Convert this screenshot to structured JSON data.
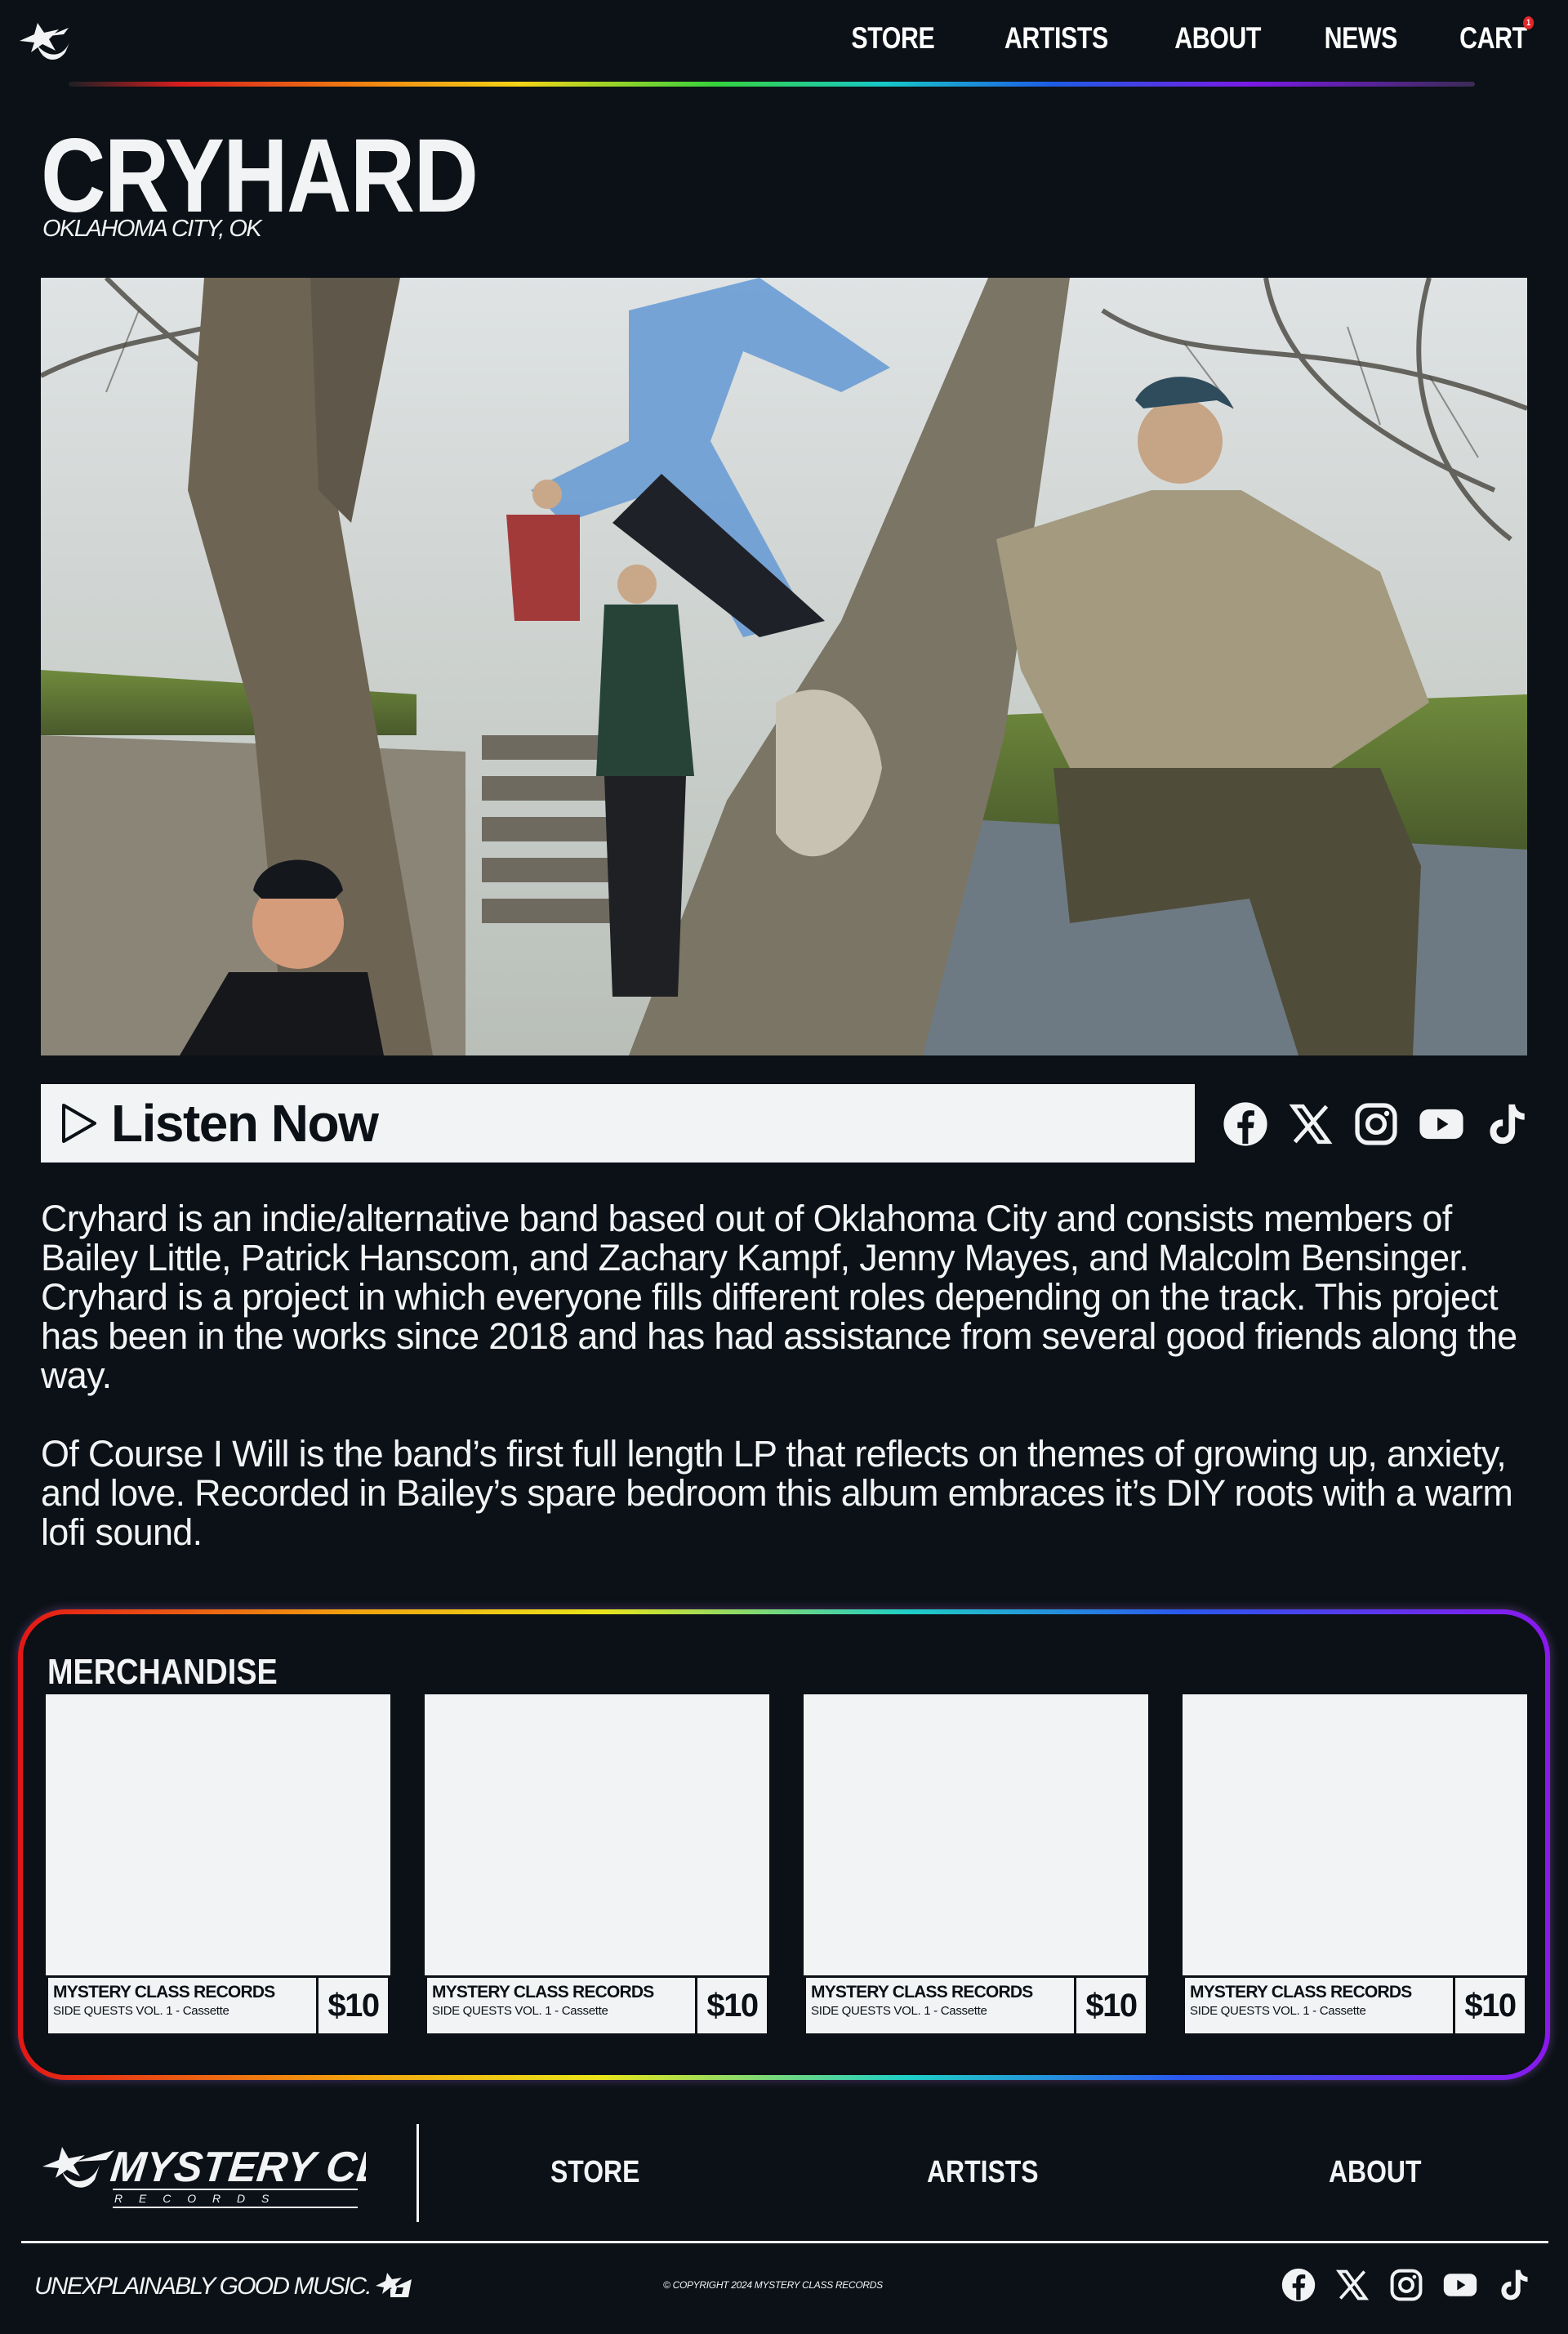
{
  "header": {
    "logo_icon": "star-swoosh-logo-icon",
    "nav": [
      {
        "label": "STORE"
      },
      {
        "label": "ARTISTS"
      },
      {
        "label": "ABOUT"
      },
      {
        "label": "NEWS"
      },
      {
        "label": "CART"
      }
    ],
    "cart_count": "1"
  },
  "artist": {
    "name": "CRYHARD",
    "location": "OKLAHOMA CITY, OK"
  },
  "listen": {
    "label": "Listen Now",
    "icon": "play-icon"
  },
  "socials": [
    "facebook-icon",
    "x-icon",
    "instagram-icon",
    "youtube-icon",
    "tiktok-icon"
  ],
  "bio": {
    "paragraph_1": "Cryhard is an indie/alternative band based out of Oklahoma City and consists members of Bailey Little, Patrick Hanscom, and Zachary Kampf, Jenny Mayes, and Malcolm Bensinger. Cryhard is a project in which everyone fills different roles depending on the track. This project has been in the works since 2018 and has had assistance from several good friends along the way.",
    "paragraph_2": "Of Course I Will is the band’s first full length LP that reflects on themes of growing up, anxiety, and love. Recorded in Bailey’s spare bedroom this album embraces it’s DIY roots with a warm lofi sound."
  },
  "merch": {
    "title": "MERCHANDISE",
    "items": [
      {
        "brand": "MYSTERY CLASS RECORDS",
        "product": "SIDE QUESTS VOL. 1 - Cassette",
        "price": "$10"
      },
      {
        "brand": "MYSTERY CLASS RECORDS",
        "product": "SIDE QUESTS VOL. 1 - Cassette",
        "price": "$10"
      },
      {
        "brand": "MYSTERY CLASS RECORDS",
        "product": "SIDE QUESTS VOL. 1 - Cassette",
        "price": "$10"
      },
      {
        "brand": "MYSTERY CLASS RECORDS",
        "product": "SIDE QUESTS VOL. 1 - Cassette",
        "price": "$10"
      }
    ]
  },
  "footer": {
    "logo_text": "MYSTERY CLASS",
    "logo_subtext": "R E C O R D S",
    "nav": [
      {
        "label": "STORE"
      },
      {
        "label": "ARTISTS"
      },
      {
        "label": "ABOUT"
      }
    ],
    "tagline": "UNEXPLAINABLY GOOD MUSIC.",
    "copyright": "© COPYRIGHT 2024 MYSTERY CLASS RECORDS"
  },
  "colors": {
    "background": "#0b1116",
    "foreground": "#f2f3f5",
    "badge": "#e3262a"
  }
}
